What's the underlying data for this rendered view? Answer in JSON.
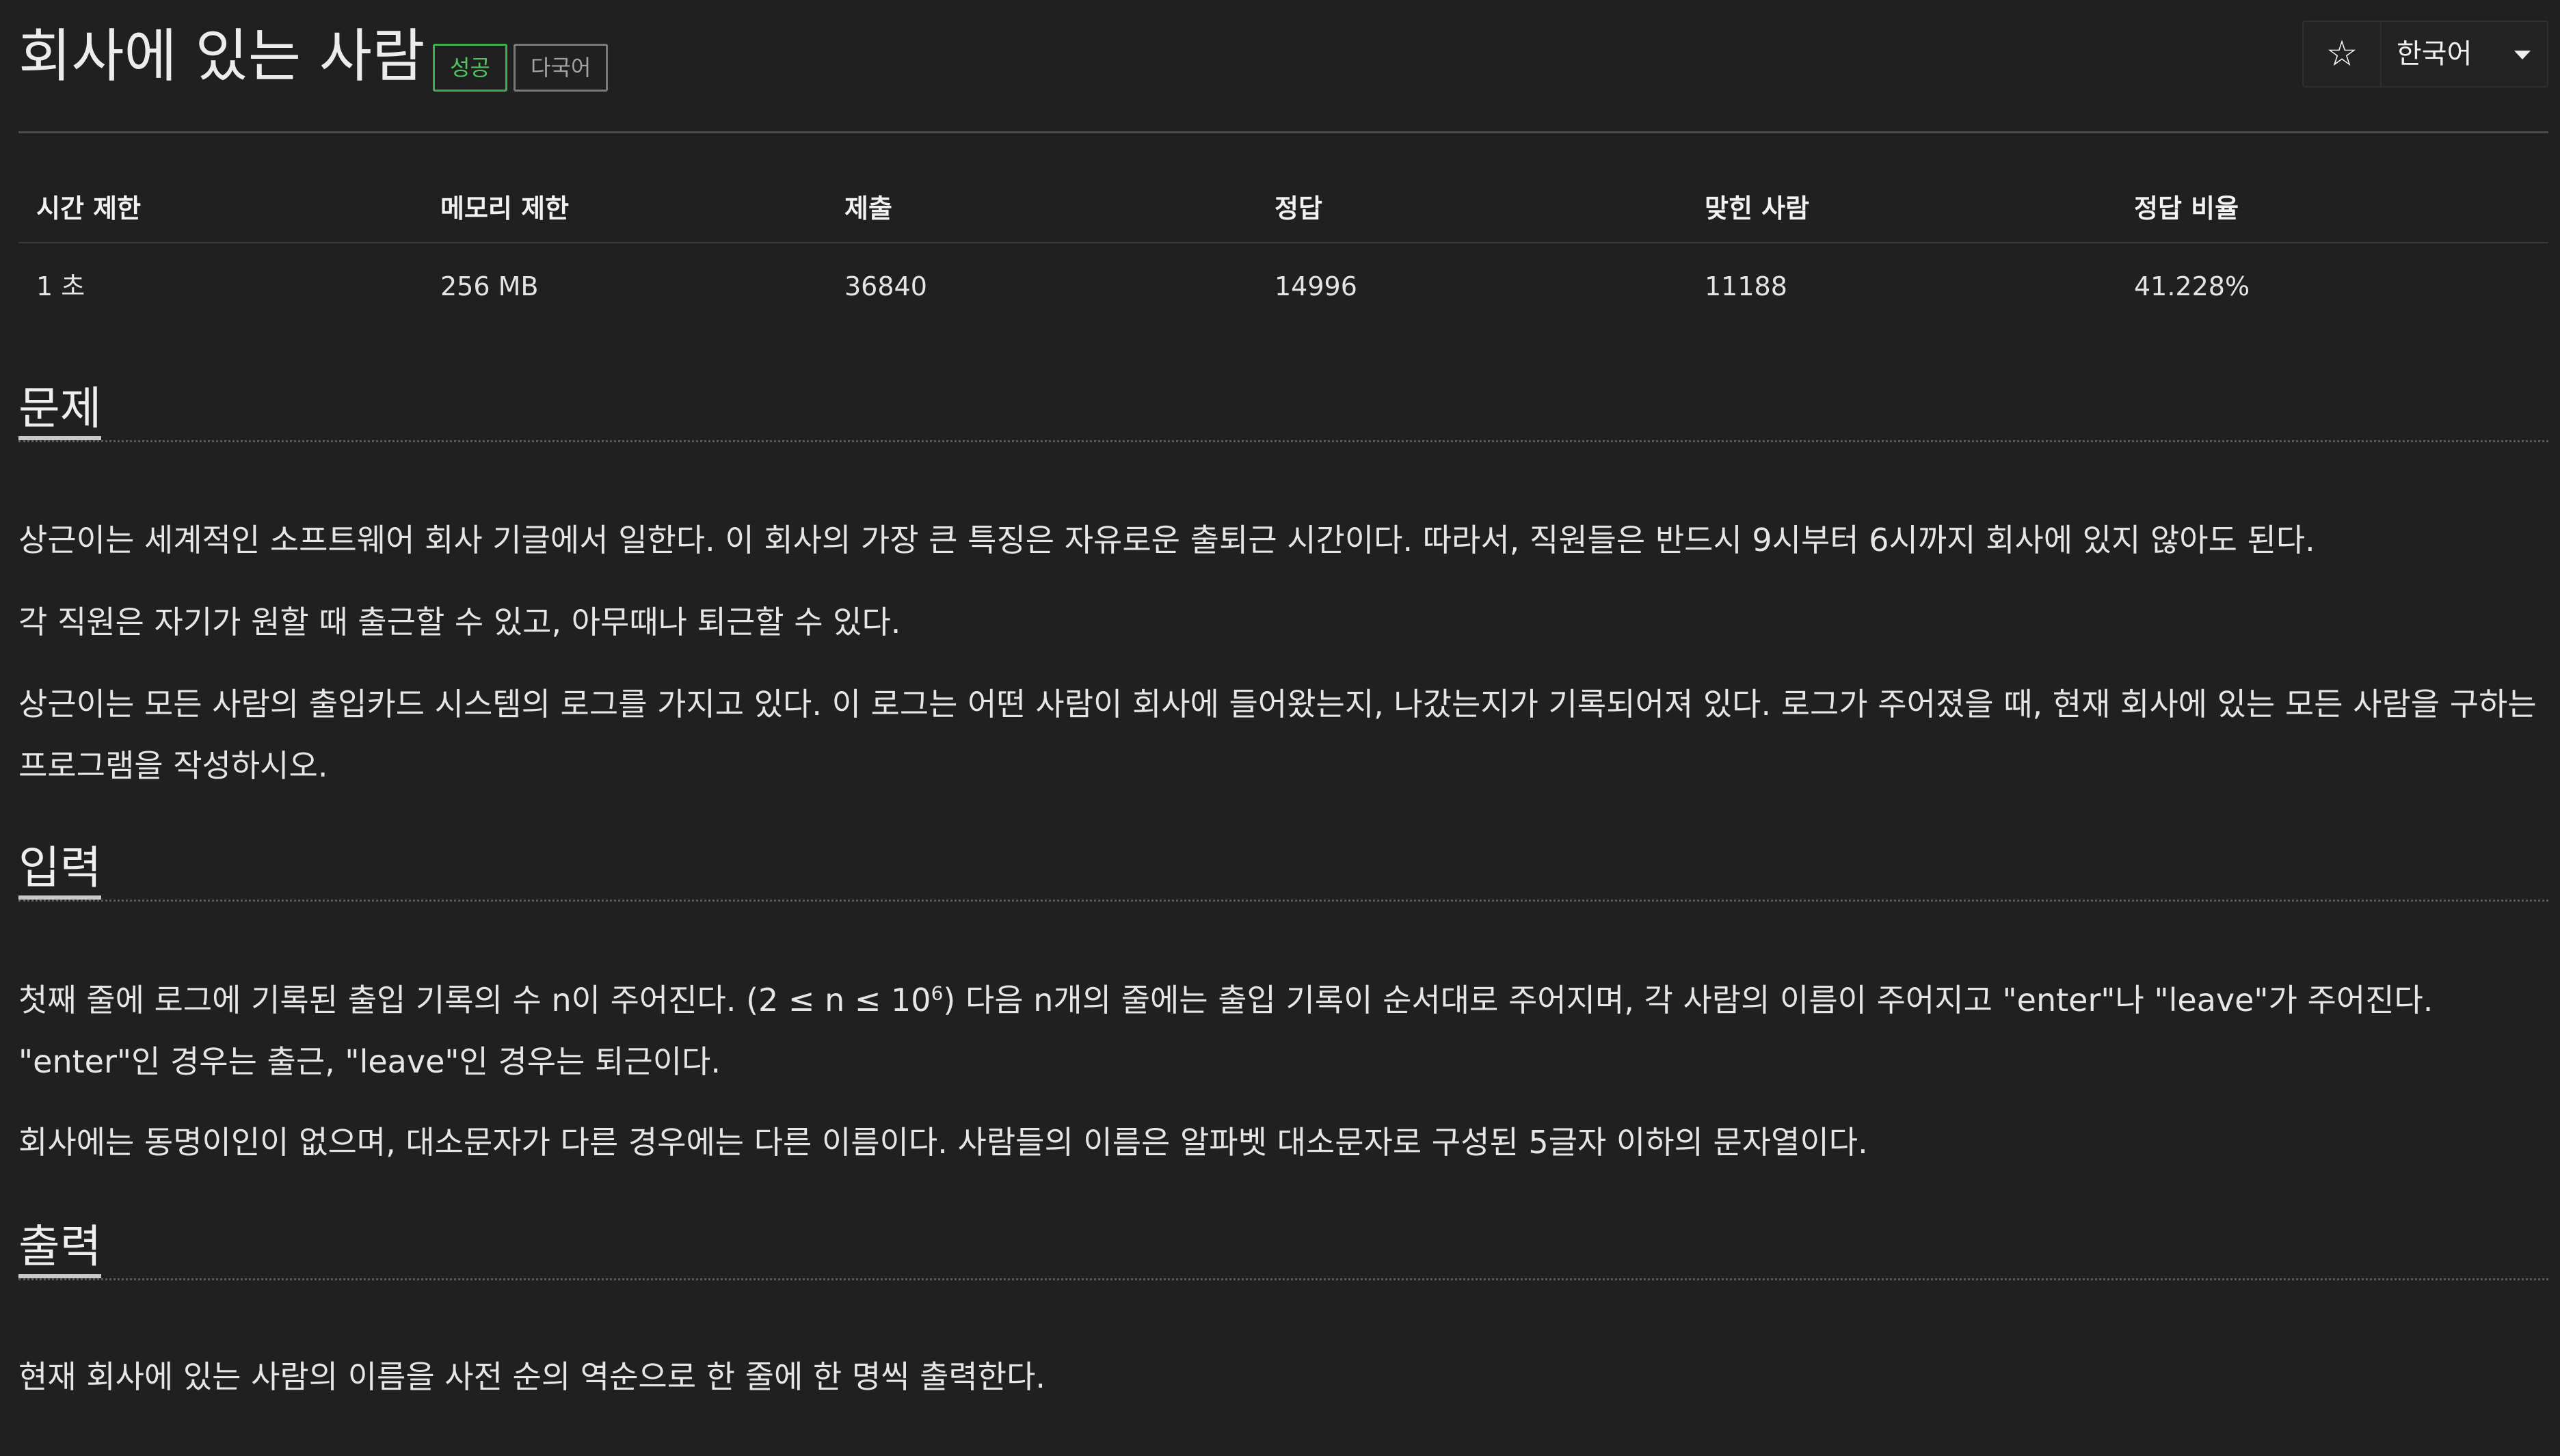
{
  "header": {
    "title": "회사에 있는 사람",
    "labels": [
      "성공",
      "다국어"
    ],
    "language": "한국어",
    "star_glyph": "☆"
  },
  "stats": {
    "headers": [
      "시간 제한",
      "메모리 제한",
      "제출",
      "정답",
      "맞힌 사람",
      "정답 비율"
    ],
    "values": [
      "1 초",
      "256 MB",
      "36840",
      "14996",
      "11188",
      "41.228%"
    ]
  },
  "sections": {
    "problem": {
      "title": "문제",
      "paragraphs": [
        "상근이는 세계적인 소프트웨어 회사 기글에서 일한다. 이 회사의 가장 큰 특징은 자유로운 출퇴근 시간이다. 따라서, 직원들은 반드시 9시부터 6시까지 회사에 있지 않아도 된다.",
        "각 직원은 자기가 원할 때 출근할 수 있고, 아무때나 퇴근할 수 있다.",
        "상근이는 모든 사람의 출입카드 시스템의 로그를 가지고 있다. 이 로그는 어떤 사람이 회사에 들어왔는지, 나갔는지가 기록되어져 있다. 로그가 주어졌을 때, 현재 회사에 있는 모든 사람을 구하는 프로그램을 작성하시오."
      ]
    },
    "input": {
      "title": "입력",
      "p1_before": "첫째 줄에 로그에 기록된 출입 기록의 수 n이 주어진다. (2 ≤ n ≤ 10",
      "p1_sup": "6",
      "p1_after": ") 다음 n개의 줄에는 출입 기록이 순서대로 주어지며, 각 사람의 이름이 주어지고 \"enter\"나 \"leave\"가 주어진다. \"enter\"인 경우는 출근, \"leave\"인 경우는 퇴근이다.",
      "p2": "회사에는 동명이인이 없으며, 대소문자가 다른 경우에는 다른 이름이다. 사람들의 이름은 알파벳 대소문자로 구성된 5글자 이하의 문자열이다."
    },
    "output": {
      "title": "출력",
      "p1": "현재 회사에 있는 사람의 이름을 사전 순의 역순으로 한 줄에 한 명씩 출력한다."
    }
  },
  "icons": {
    "star": "star-icon",
    "caret": "caret-down-icon"
  },
  "colors": {
    "background": "#202020",
    "success": "#52c45f",
    "text": "#e6e6e6"
  }
}
